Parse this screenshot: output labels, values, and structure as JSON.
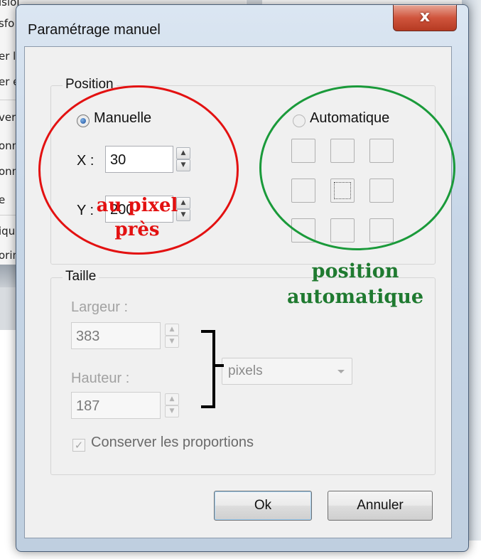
{
  "background_app": {
    "menu_fragments": [
      "ision",
      "sfo",
      "er l",
      "er e",
      "ver",
      "onn",
      "onn",
      "e",
      "iqu",
      "orin"
    ]
  },
  "dialog": {
    "title": "Paramétrage manuel",
    "close_glyph": "x",
    "position_group": {
      "legend": "Position",
      "manual_radio": {
        "label": "Manuelle",
        "checked": true
      },
      "x_label": "X :",
      "x_value": "30",
      "y_label": "Y :",
      "y_value": "200",
      "auto_radio": {
        "label": "Automatique",
        "checked": false
      },
      "auto_grid_selected_cell": 4
    },
    "size_group": {
      "legend": "Taille",
      "width_label": "Largeur :",
      "width_value": "383",
      "height_label": "Hauteur :",
      "height_value": "187",
      "unit_select": "pixels",
      "keep_ratio": {
        "label": "Conserver les proportions",
        "checked": true
      }
    },
    "buttons": {
      "ok": "Ok",
      "cancel": "Annuler"
    }
  },
  "annotations": {
    "red_note": [
      "au pixel",
      "près"
    ],
    "green_note": [
      "position",
      "automatique"
    ],
    "colors": {
      "red": "#e31111",
      "green": "#1f7a30"
    }
  },
  "icons": {
    "spin_up": "▲",
    "spin_down": "▼",
    "check": "✓"
  }
}
